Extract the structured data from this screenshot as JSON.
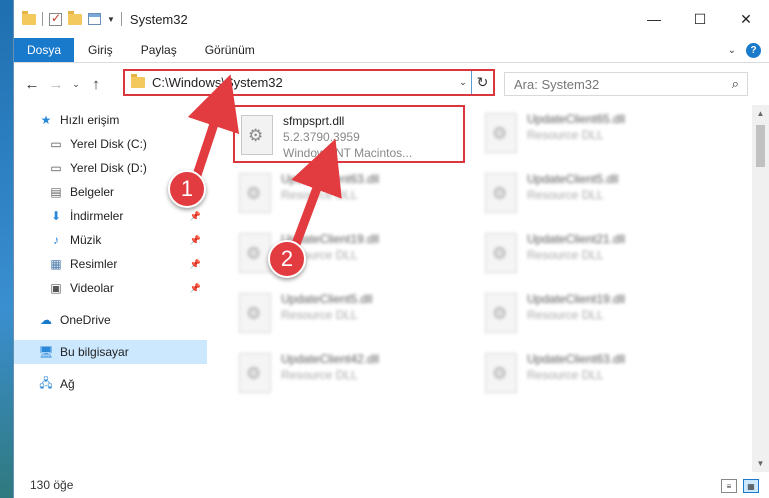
{
  "window": {
    "title": "System32"
  },
  "ribbon": {
    "tabs": [
      "Dosya",
      "Giriş",
      "Paylaş",
      "Görünüm"
    ]
  },
  "address": {
    "path": "C:\\Windows\\System32",
    "search_placeholder": "Ara: System32"
  },
  "nav": {
    "items": [
      {
        "label": "Hızlı erişim",
        "icon": "star-icon"
      },
      {
        "label": "Yerel Disk (C:)",
        "icon": "drive-icon"
      },
      {
        "label": "Yerel Disk (D:)",
        "icon": "drive-icon"
      },
      {
        "label": "Belgeler",
        "icon": "document-icon"
      },
      {
        "label": "İndirmeler",
        "icon": "download-icon"
      },
      {
        "label": "Müzik",
        "icon": "music-icon"
      },
      {
        "label": "Resimler",
        "icon": "pictures-icon"
      },
      {
        "label": "Videolar",
        "icon": "video-icon"
      },
      {
        "label": "OneDrive",
        "icon": "cloud-icon"
      },
      {
        "label": "Bu bilgisayar",
        "icon": "computer-icon"
      },
      {
        "label": "Ağ",
        "icon": "network-icon"
      }
    ]
  },
  "files": [
    {
      "name": "sfmpsprt.dll",
      "line2": "5.2.3790.3959",
      "line3": "Windows NT Macintos..."
    },
    {
      "name": "UpdateClient65.dll",
      "line2": "Resource DLL"
    },
    {
      "name": "UpdateClient63.dll",
      "line2": "Resource DLL"
    },
    {
      "name": "UpdateClient5.dll",
      "line2": "Resource DLL"
    },
    {
      "name": "UpdateClient19.dll",
      "line2": "Resource DLL"
    },
    {
      "name": "UpdateClient21.dll",
      "line2": "Resource DLL"
    },
    {
      "name": "UpdateClient5.dll",
      "line2": "Resource DLL"
    },
    {
      "name": "UpdateClient19.dll",
      "line2": "Resource DLL"
    },
    {
      "name": "UpdateClient42.dll",
      "line2": "Resource DLL"
    },
    {
      "name": "UpdateClient63.dll",
      "line2": "Resource DLL"
    }
  ],
  "status": {
    "count": "130 öğe"
  },
  "annotations": {
    "step1": "1",
    "step2": "2",
    "color": "#e23b40"
  }
}
